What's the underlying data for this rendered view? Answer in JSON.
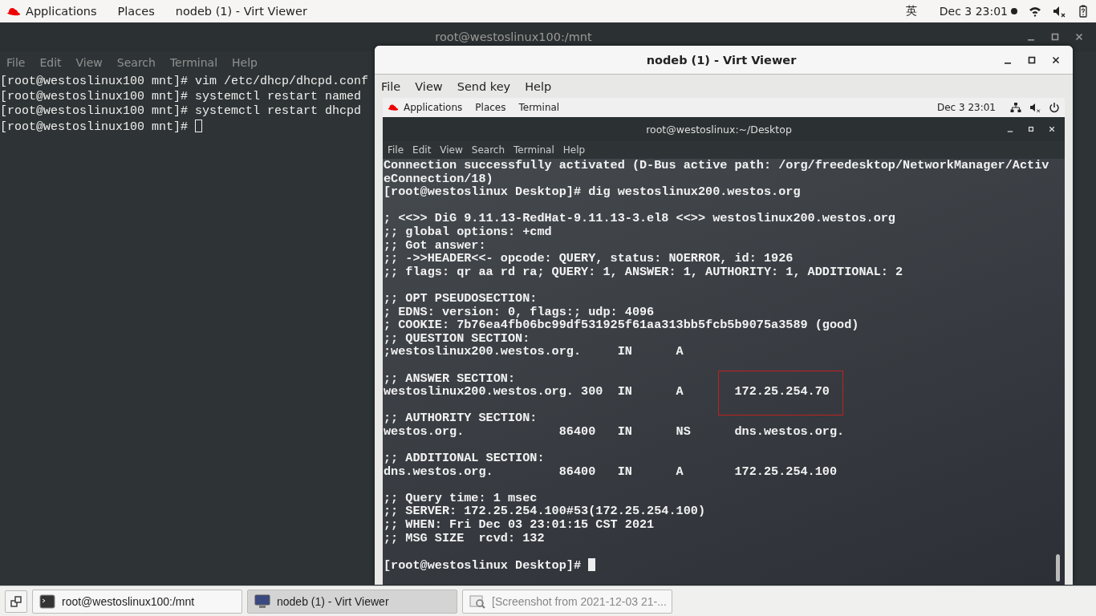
{
  "top_bar": {
    "menus": [
      "Applications",
      "Places",
      "nodeb (1) - Virt Viewer"
    ],
    "input_method": "英",
    "clock": "Dec 3  23:01",
    "notification": true
  },
  "host_terminal": {
    "title": "root@westoslinux100:/mnt",
    "menu": [
      "File",
      "Edit",
      "View",
      "Search",
      "Terminal",
      "Help"
    ],
    "lines": [
      "[root@westoslinux100 mnt]# vim /etc/dhcp/dhcpd.conf",
      "[root@westoslinux100 mnt]# systemctl restart named",
      "[root@westoslinux100 mnt]# systemctl restart dhcpd",
      "[root@westoslinux100 mnt]# "
    ],
    "cursor_focused": false
  },
  "viewer_window": {
    "title": "nodeb (1) - Virt Viewer",
    "menu": [
      "File",
      "View",
      "Send key",
      "Help"
    ],
    "guest_top_bar": {
      "menus": [
        "Applications",
        "Places",
        "Terminal"
      ],
      "clock": "Dec 3  23:01"
    },
    "guest_terminal": {
      "title": "root@westoslinux:~/Desktop",
      "menu": [
        "File",
        "Edit",
        "View",
        "Search",
        "Terminal",
        "Help"
      ],
      "blocks": [
        [
          "Connection successfully activated (D-Bus active path: /org/freedesktop/NetworkManager/Activ",
          "eConnection/18)",
          "[root@westoslinux Desktop]# dig westoslinux200.westos.org"
        ],
        [
          "; <<>> DiG 9.11.13-RedHat-9.11.13-3.el8 <<>> westoslinux200.westos.org",
          ";; global options: +cmd",
          ";; Got answer:",
          ";; ->>HEADER<<- opcode: QUERY, status: NOERROR, id: 1926",
          ";; flags: qr aa rd ra; QUERY: 1, ANSWER: 1, AUTHORITY: 1, ADDITIONAL: 2"
        ],
        [
          ";; OPT PSEUDOSECTION:",
          "; EDNS: version: 0, flags:; udp: 4096",
          "; COOKIE: 7b76ea4fb06bc99df531925f61aa313bb5fcb5b9075a3589 (good)",
          ";; QUESTION SECTION:",
          ";westoslinux200.westos.org.     IN      A"
        ],
        [
          ";; ANSWER SECTION:",
          "westoslinux200.westos.org. 300  IN      A       172.25.254.70"
        ],
        [
          ";; AUTHORITY SECTION:",
          "westos.org.             86400   IN      NS      dns.westos.org."
        ],
        [
          ";; ADDITIONAL SECTION:",
          "dns.westos.org.         86400   IN      A       172.25.254.100"
        ],
        [
          ";; Query time: 1 msec",
          ";; SERVER: 172.25.254.100#53(172.25.254.100)",
          ";; WHEN: Fri Dec 03 23:01:15 CST 2021",
          ";; MSG SIZE  rcvd: 132"
        ],
        [
          "[root@westoslinux Desktop]# "
        ]
      ],
      "cursor_focused": true,
      "highlight": true
    }
  },
  "taskbar": {
    "tasks": [
      {
        "kind": "terminal",
        "label": "root@westoslinux100:/mnt",
        "selected": false,
        "minimized": false
      },
      {
        "kind": "viewer",
        "label": "nodeb (1) - Virt Viewer",
        "selected": true,
        "minimized": false
      },
      {
        "kind": "image",
        "label": "[Screenshot from 2021-12-03 21-...",
        "selected": false,
        "minimized": true
      }
    ]
  }
}
